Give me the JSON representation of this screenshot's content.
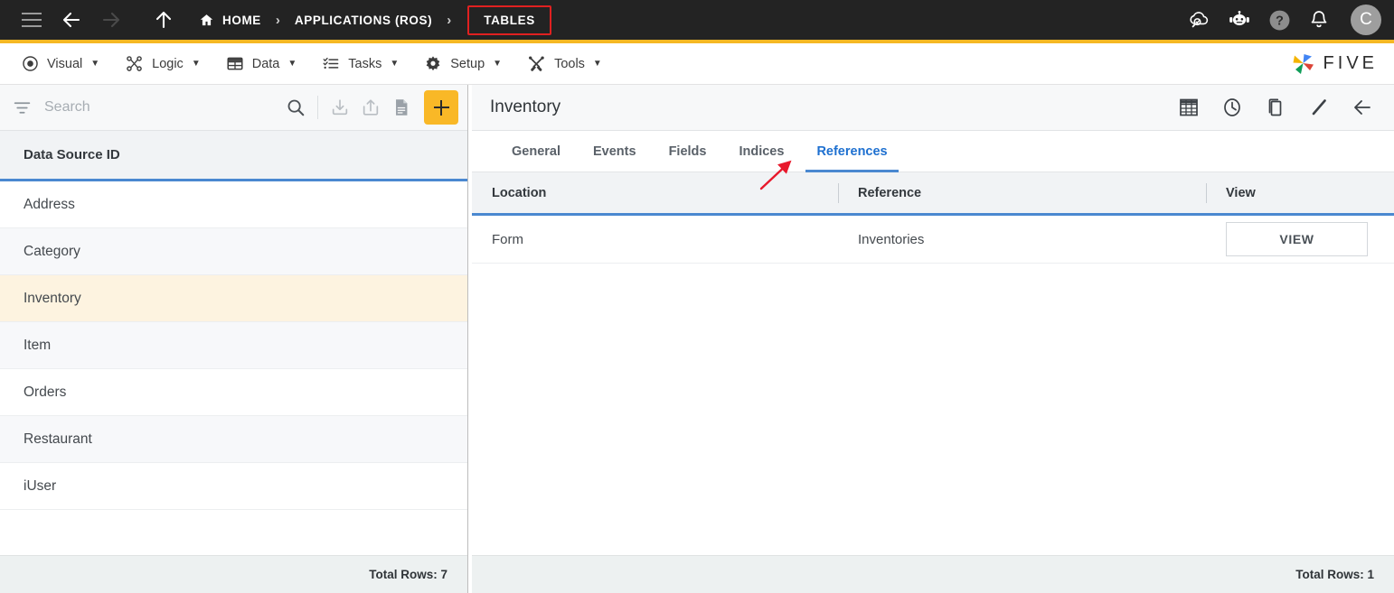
{
  "topbar": {
    "icons": {
      "menu": "hamburger-icon",
      "back": "back-arrow-icon",
      "forward": "forward-arrow-icon",
      "up": "up-arrow-icon",
      "cloud_search": "cloud-search-icon",
      "chatbot": "robot-chat-icon",
      "help": "help-circle-icon",
      "notifications": "bell-icon"
    },
    "breadcrumbs": [
      {
        "label": "HOME",
        "icon": "home-icon",
        "highlighted": false
      },
      {
        "label": "APPLICATIONS (ROS)",
        "highlighted": false
      },
      {
        "label": "TABLES",
        "highlighted": true
      }
    ],
    "separator": "›",
    "avatar_initial": "C",
    "accent_color": "#f5b824"
  },
  "menubar": {
    "items": [
      {
        "label": "Visual",
        "icon": "eye-icon",
        "caret": "▼"
      },
      {
        "label": "Logic",
        "icon": "logic-nodes-icon",
        "caret": "▼"
      },
      {
        "label": "Data",
        "icon": "table-grid-icon",
        "caret": "▼"
      },
      {
        "label": "Tasks",
        "icon": "checklist-icon",
        "caret": "▼"
      },
      {
        "label": "Setup",
        "icon": "gear-icon",
        "caret": "▼"
      },
      {
        "label": "Tools",
        "icon": "tools-cross-icon",
        "caret": "▼"
      }
    ],
    "brand": "FIVE"
  },
  "left_panel": {
    "search": {
      "placeholder": "Search",
      "value": ""
    },
    "toolbar_icons": {
      "filter": "filter-icon",
      "search": "search-icon",
      "import": "import-download-icon",
      "export": "export-share-icon",
      "document": "document-icon",
      "add": "plus-icon"
    },
    "column_header": "Data Source ID",
    "rows": [
      {
        "label": "Address",
        "selected": false
      },
      {
        "label": "Category",
        "selected": false
      },
      {
        "label": "Inventory",
        "selected": true
      },
      {
        "label": "Item",
        "selected": false
      },
      {
        "label": "Orders",
        "selected": false
      },
      {
        "label": "Restaurant",
        "selected": false
      },
      {
        "label": "iUser",
        "selected": false
      }
    ],
    "footer": "Total Rows: 7"
  },
  "right_panel": {
    "title": "Inventory",
    "actions": [
      {
        "name": "table-view-icon"
      },
      {
        "name": "history-clock-icon"
      },
      {
        "name": "copy-icon"
      },
      {
        "name": "edit-pencil-icon"
      },
      {
        "name": "back-arrow-icon"
      }
    ],
    "tabs": [
      {
        "label": "General",
        "active": false
      },
      {
        "label": "Events",
        "active": false
      },
      {
        "label": "Fields",
        "active": false
      },
      {
        "label": "Indices",
        "active": false
      },
      {
        "label": "References",
        "active": true
      }
    ],
    "table": {
      "columns": [
        "Location",
        "Reference",
        "View"
      ],
      "rows": [
        {
          "location": "Form",
          "reference": "Inventories",
          "view_label": "VIEW"
        }
      ]
    },
    "footer": "Total Rows: 1"
  },
  "annotation": {
    "arrow_color": "#e8192c",
    "points_to": "References"
  }
}
